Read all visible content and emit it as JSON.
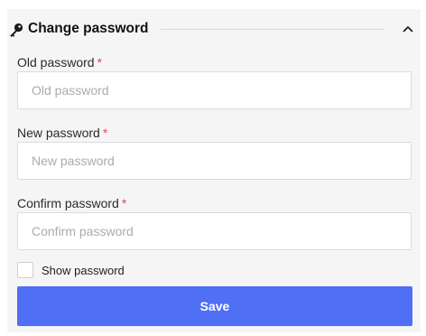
{
  "section": {
    "title": "Change password",
    "icon": "key-icon",
    "toggle_icon": "chevron-up-icon"
  },
  "fields": {
    "old_password": {
      "label": "Old password",
      "required_marker": "*",
      "placeholder": "Old password",
      "value": ""
    },
    "new_password": {
      "label": "New password",
      "required_marker": "*",
      "placeholder": "New password",
      "value": ""
    },
    "confirm_password": {
      "label": "Confirm password",
      "required_marker": "*",
      "placeholder": "Confirm password",
      "value": ""
    }
  },
  "show_password": {
    "label": "Show password",
    "checked": false
  },
  "save_button": {
    "label": "Save"
  },
  "colors": {
    "accent": "#4f6ff5",
    "required": "#e5484d",
    "panel_background": "#f5f5f6",
    "placeholder": "#a9abb1"
  }
}
